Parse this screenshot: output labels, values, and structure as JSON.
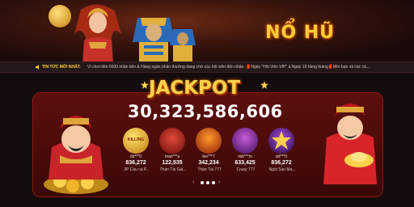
{
  "banner": {
    "title": "NỔ HŨ"
  },
  "news": {
    "label": "TIN TỨC MỚI NHẤT:",
    "ticker": "Vì chơi đến 6000 nhận tiền & Hàng ngàn phần thưởng đang chờ các hội viên đến nhận. 🧧Ngày \"Hội Viên VIP\" á Ngày 19 hàng tháng🧧Mời bạn và các cả..."
  },
  "jackpot": {
    "title": "JACKPOT",
    "value": "30,323,586,606"
  },
  "games": [
    {
      "user": "dd***0",
      "amount": "836,272",
      "name": "3P Câu cá P..."
    },
    {
      "user": "man***a",
      "amount": "122,535",
      "name": "Thần Tài Già..."
    },
    {
      "user": "lee***7",
      "amount": "342,234",
      "name": "Thần Tài 777"
    },
    {
      "user": "mik***m",
      "amount": "633,425",
      "name": "Crazy 777"
    },
    {
      "user": "dd***0",
      "amount": "836,272",
      "name": "Ngôi Sao Ma..."
    }
  ],
  "game_badges": {
    "first": "KILLING"
  },
  "colors": {
    "gold": "#ffd14a",
    "panel": "#5c0f0c",
    "background": "#140c0c"
  }
}
